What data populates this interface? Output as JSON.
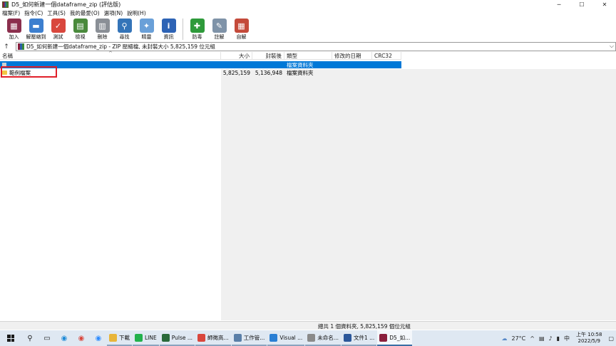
{
  "window": {
    "title": "D5_如何新建一個dataframe_zip (評估版)",
    "controls": {
      "minimize": "─",
      "maximize": "☐",
      "close": "✕"
    }
  },
  "menu": [
    "檔案(F)",
    "指令(C)",
    "工具(S)",
    "我的最愛(O)",
    "選項(N)",
    "說明(H)"
  ],
  "toolbar": [
    {
      "label": "加入",
      "icon": "add-icon",
      "color": "#8b2f4d",
      "glyph": "▦"
    },
    {
      "label": "解壓縮到",
      "icon": "extract-folder-icon",
      "color": "#3d7fcf",
      "glyph": "▬"
    },
    {
      "label": "測試",
      "icon": "test-icon",
      "color": "#d9473d",
      "glyph": "✓"
    },
    {
      "label": "檢視",
      "icon": "view-book-icon",
      "color": "#4a8a3c",
      "glyph": "▤"
    },
    {
      "label": "刪除",
      "icon": "trash-icon",
      "color": "#8a8f96",
      "glyph": "▥"
    },
    {
      "label": "尋找",
      "icon": "find-icon",
      "color": "#3474b8",
      "glyph": "⚲"
    },
    {
      "label": "精靈",
      "icon": "wizard-icon",
      "color": "#6aa0d8",
      "glyph": "✦"
    },
    {
      "label": "資訊",
      "icon": "info-icon",
      "color": "#2d63b5",
      "glyph": "i"
    },
    {
      "label": "防毒",
      "icon": "antivirus-icon",
      "color": "#2e9a3a",
      "glyph": "✚"
    },
    {
      "label": "註解",
      "icon": "comment-icon",
      "color": "#7f93a8",
      "glyph": "✎"
    },
    {
      "label": "自解",
      "icon": "sfx-icon",
      "color": "#c44a3a",
      "glyph": "▦"
    }
  ],
  "address": {
    "up": "↑",
    "text": "D5_如何新建一個dataframe_zip - ZIP 壓縮檔, 未封裝大小 5,825,159 位元組",
    "dropdown": "⌵"
  },
  "columns": {
    "name": "名稱",
    "size": "大小",
    "packed": "封裝後",
    "type": "類型",
    "modified": "修改的日期",
    "crc": "CRC32",
    "sort_caret": "^"
  },
  "rows": [
    {
      "name": "..",
      "size": "",
      "packed": "",
      "type": "檔案資料夾",
      "modified": "",
      "crc": "",
      "selected": true
    },
    {
      "name": "範例檔案",
      "size": "5,825,159",
      "packed": "5,136,948",
      "type": "檔案資料夾",
      "modified": "",
      "crc": "",
      "selected": false
    }
  ],
  "status": "總共 1 個資料夾, 5,825,159 個位元組",
  "taskbar": {
    "apps": [
      {
        "label": "下載",
        "icon": "folder-icon",
        "color": "#e8b53a"
      },
      {
        "label": "LINE",
        "icon": "line-icon",
        "color": "#22b14c"
      },
      {
        "label": "Pulse ...",
        "icon": "pulse-icon",
        "color": "#2a6a3a"
      },
      {
        "label": "師徵高...",
        "icon": "chrome-icon",
        "color": "#d9473d"
      },
      {
        "label": "工作管...",
        "icon": "task-manager-icon",
        "color": "#5a7fa8"
      },
      {
        "label": "Visual ...",
        "icon": "vscode-icon",
        "color": "#2a7fd4"
      },
      {
        "label": "未命名...",
        "icon": "paint-icon",
        "color": "#8a8a8a"
      },
      {
        "label": "文件1 ...",
        "icon": "word-icon",
        "color": "#2b579a"
      },
      {
        "label": "D5_如...",
        "icon": "winrar-icon",
        "color": "#8b1f3d"
      }
    ],
    "weather": "27°C",
    "ime": "中",
    "time": "上午 10:58",
    "date": "2022/5/9"
  }
}
